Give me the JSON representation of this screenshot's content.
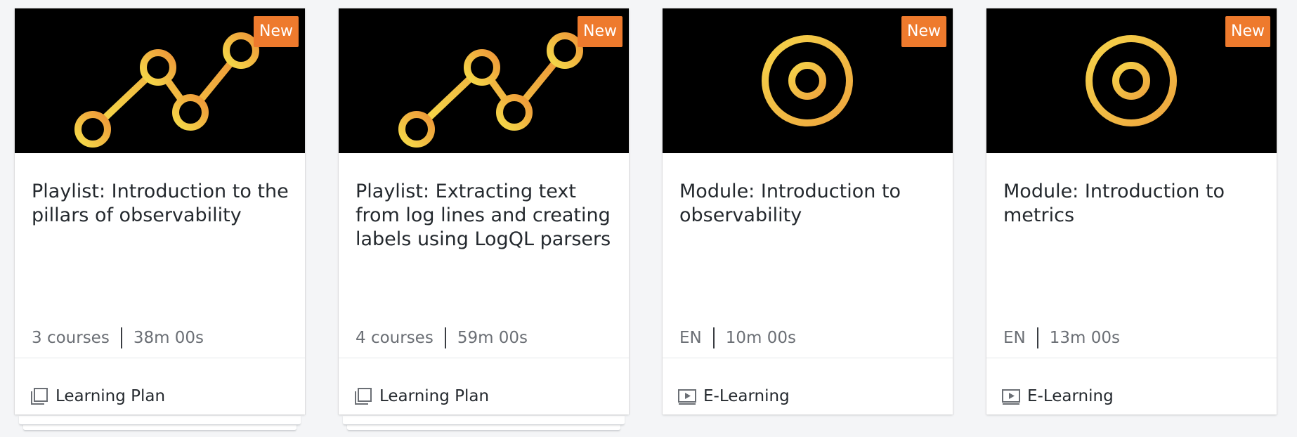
{
  "cards": [
    {
      "badge": "New",
      "title": "Playlist: Introduction to the pillars of observability",
      "meta_left": "3 courses",
      "meta_right": "38m 00s",
      "type_label": "Learning Plan",
      "thumb_icon": "line-chart-icon",
      "type_icon": "stacked-pages-icon"
    },
    {
      "badge": "New",
      "title": "Playlist: Extracting text from log lines and creating labels using LogQL parsers",
      "meta_left": "4 courses",
      "meta_right": "59m 00s",
      "type_label": "Learning Plan",
      "thumb_icon": "line-chart-icon",
      "type_icon": "stacked-pages-icon"
    },
    {
      "badge": "New",
      "title": "Module: Introduction to observability",
      "meta_left": "EN",
      "meta_right": "10m 00s",
      "type_label": "E-Learning",
      "thumb_icon": "crosshair-target-icon",
      "type_icon": "play-screen-icon"
    },
    {
      "badge": "New",
      "title": "Module: Introduction to metrics",
      "meta_left": "EN",
      "meta_right": "13m 00s",
      "type_label": "E-Learning",
      "thumb_icon": "crosshair-target-icon",
      "type_icon": "play-screen-icon"
    }
  ],
  "colors": {
    "badge": "#ee7a2d",
    "icon_gradient_start": "#f2d44a",
    "icon_gradient_end": "#ef9a3c",
    "thumbnail_bg": "#000000"
  }
}
